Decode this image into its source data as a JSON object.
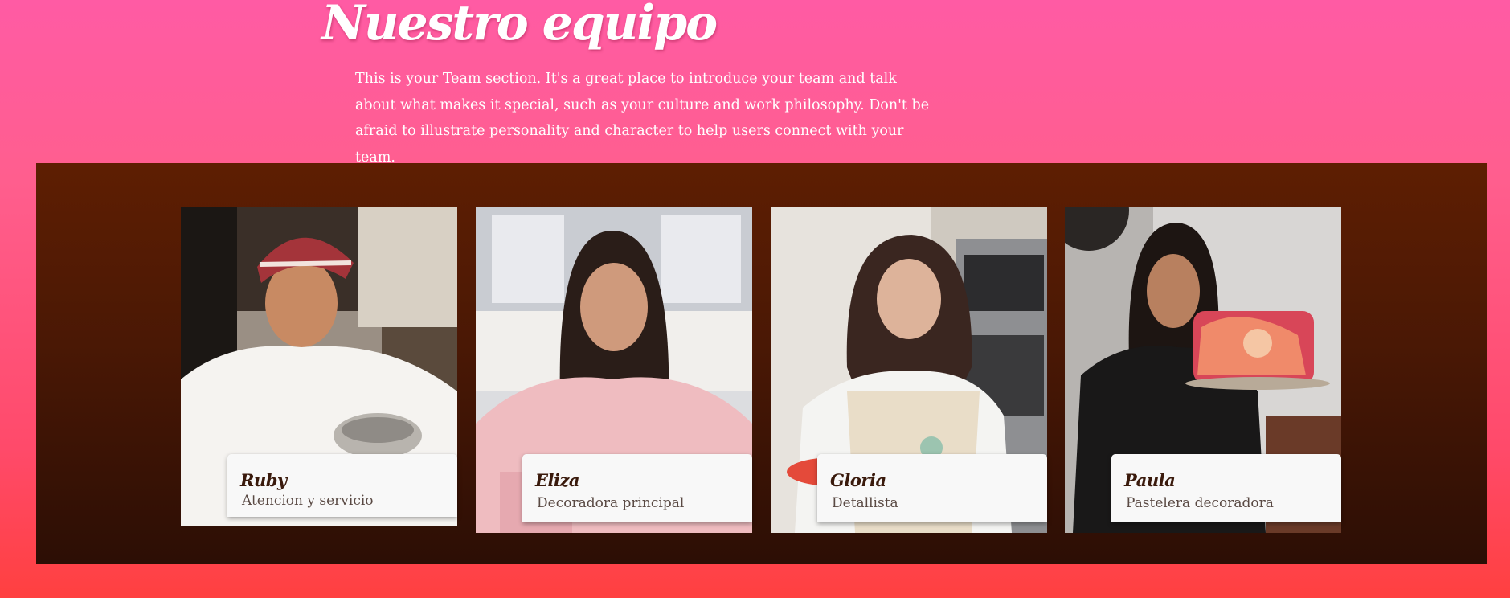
{
  "section": {
    "title": "Nuestro equipo",
    "intro": "This is your Team section. It's a great place to introduce your team and talk about what makes it special, such as your culture and work philosophy. Don't be afraid to illustrate personality and character to help users connect with your team."
  },
  "team": [
    {
      "name": "Ruby",
      "role": "Atencion y servicio",
      "photo_icon": "chef-photo"
    },
    {
      "name": "Eliza",
      "role": "Decoradora principal",
      "photo_icon": "pastry-chef-photo"
    },
    {
      "name": "Gloria",
      "role": "Detallista",
      "photo_icon": "baker-photo"
    },
    {
      "name": "Paula",
      "role": "Pastelera decoradora",
      "photo_icon": "cake-decorator-photo"
    }
  ],
  "colors": {
    "page_gradient_top": "#ff5ba4",
    "page_gradient_bottom": "#ff4040",
    "panel_top": "#5e1e02",
    "panel_bottom": "#2c0e05",
    "caption_bg": "#f8f8f8"
  }
}
